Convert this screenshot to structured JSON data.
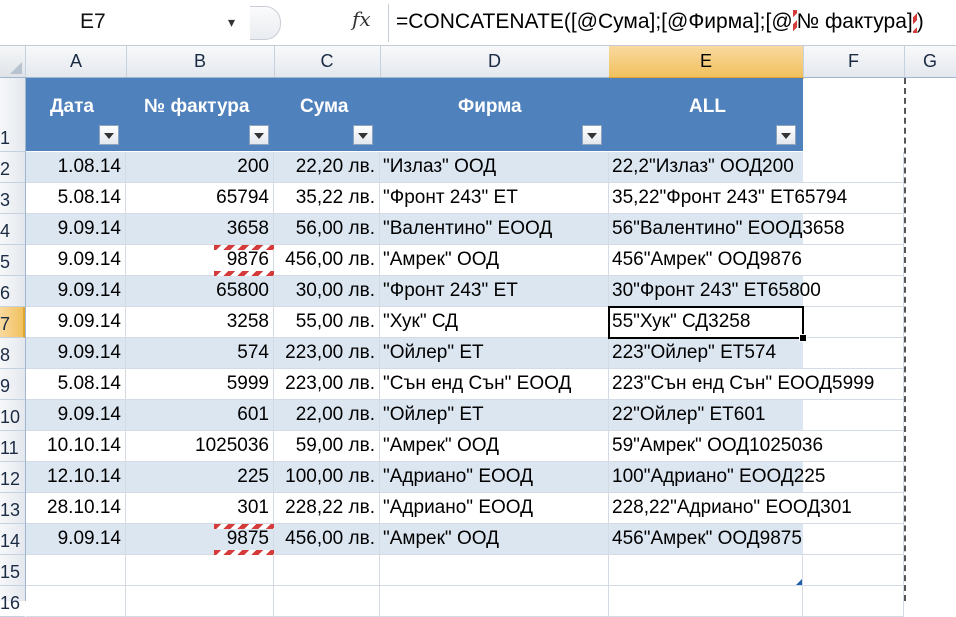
{
  "formula_bar": {
    "name_box": "E7",
    "name_box_arrow": "▾",
    "fx_label": "fx",
    "formula_prefix": "=CONCATENATE([@Сума];[@Фирма];[@",
    "formula_ref": "№ фактура]",
    "formula_suffix": ")"
  },
  "columns": [
    "A",
    "B",
    "C",
    "D",
    "E",
    "F",
    "G"
  ],
  "selected_column": "E",
  "rows": [
    "1",
    "2",
    "3",
    "4",
    "5",
    "6",
    "7",
    "8",
    "9",
    "10",
    "11",
    "12",
    "13",
    "14",
    "15",
    "16"
  ],
  "selected_row": "7",
  "table": {
    "headers": [
      "Дата",
      "№ фактура",
      "Сума",
      "Фирма",
      "ALL"
    ],
    "rows": [
      {
        "date": "1.08.14",
        "inv": "200",
        "sum": "22,20 лв.",
        "firm": "\"Излаз\" ООД",
        "all": "22,2\"Излаз\" ООД200"
      },
      {
        "date": "5.08.14",
        "inv": "65794",
        "sum": "35,22 лв.",
        "firm": "\"Фронт 243\" ЕТ",
        "all": "35,22\"Фронт 243\" ЕТ65794"
      },
      {
        "date": "9.09.14",
        "inv": "3658",
        "sum": "56,00 лв.",
        "firm": "\"Валентино\" ЕООД",
        "all": "56\"Валентино\" ЕООД3658"
      },
      {
        "date": "9.09.14",
        "inv": "9876",
        "sum": "456,00 лв.",
        "firm": "\"Амрек\" ООД",
        "all": "456\"Амрек\" ООД9876"
      },
      {
        "date": "9.09.14",
        "inv": "65800",
        "sum": "30,00 лв.",
        "firm": "\"Фронт 243\" ЕТ",
        "all": "30\"Фронт 243\" ЕТ65800"
      },
      {
        "date": "9.09.14",
        "inv": "3258",
        "sum": "55,00 лв.",
        "firm": "\"Хук\" СД",
        "all": "55\"Хук\" СД3258"
      },
      {
        "date": "9.09.14",
        "inv": "574",
        "sum": "223,00 лв.",
        "firm": "\"Ойлер\" ЕТ",
        "all": "223\"Ойлер\" ЕТ574"
      },
      {
        "date": "5.08.14",
        "inv": "5999",
        "sum": "223,00 лв.",
        "firm": "\"Сън енд Сън\" ЕООД",
        "all": "223\"Сън енд Сън\" ЕООД5999"
      },
      {
        "date": "9.09.14",
        "inv": "601",
        "sum": "22,00 лв.",
        "firm": "\"Ойлер\" ЕТ",
        "all": "22\"Ойлер\" ЕТ601"
      },
      {
        "date": "10.10.14",
        "inv": "1025036",
        "sum": "59,00 лв.",
        "firm": "\"Амрек\" ООД",
        "all": "59\"Амрек\" ООД1025036"
      },
      {
        "date": "12.10.14",
        "inv": "225",
        "sum": "100,00 лв.",
        "firm": "\"Адриано\" ЕООД",
        "all": "100\"Адриано\" ЕООД225"
      },
      {
        "date": "28.10.14",
        "inv": "301",
        "sum": "228,22 лв.",
        "firm": "\"Адриано\" ЕООД",
        "all": "228,22\"Адриано\" ЕООД301"
      },
      {
        "date": "9.09.14",
        "inv": "9875",
        "sum": "456,00 лв.",
        "firm": "\"Амрек\" ООД",
        "all": "456\"Амрек\" ООД9875"
      }
    ]
  },
  "colors": {
    "header_fill": "#4f81bd",
    "band_fill": "#dce6f1",
    "selected_header": "#f1c15f",
    "reference_hatch": "#d63b3b"
  }
}
